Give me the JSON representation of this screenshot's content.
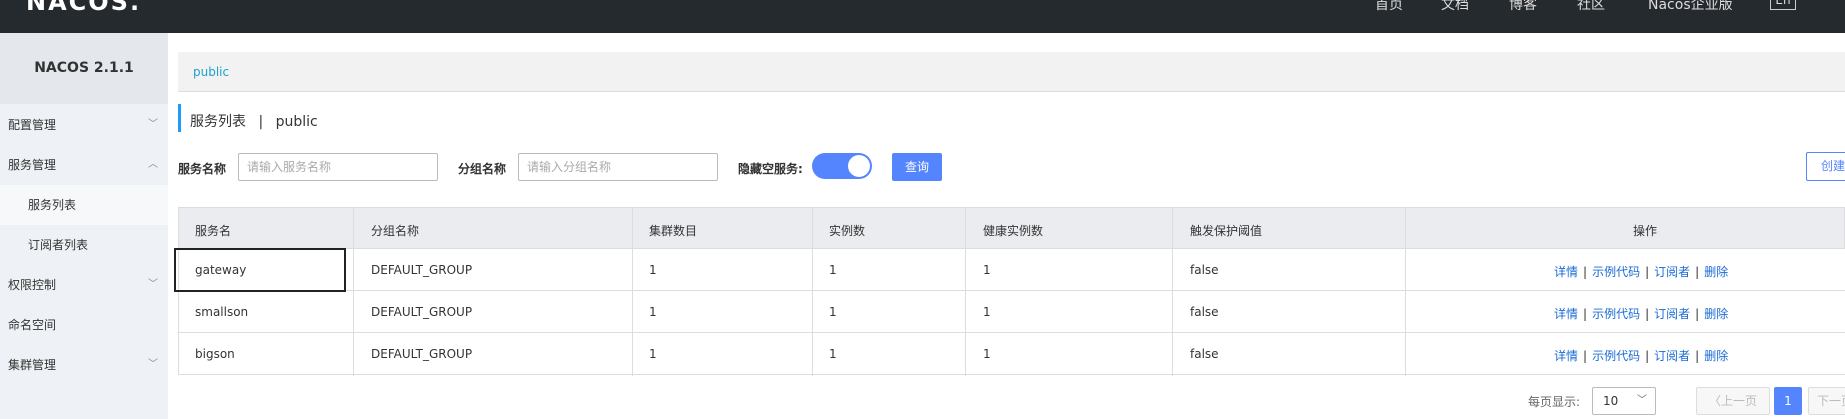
{
  "header": {
    "logo": "NACOS.",
    "nav": [
      "首页",
      "文档",
      "博客",
      "社区",
      "Nacos企业版"
    ],
    "lang": "En"
  },
  "sidebar": {
    "version": "NACOS 2.1.1",
    "items": [
      {
        "label": "配置管理",
        "arrow": "chevron-down"
      },
      {
        "label": "服务管理",
        "arrow": "chevron-up"
      },
      {
        "label": "服务列表"
      },
      {
        "label": "订阅者列表"
      },
      {
        "label": "权限控制",
        "arrow": "chevron-down"
      },
      {
        "label": "命名空间"
      },
      {
        "label": "集群管理",
        "arrow": "chevron-down"
      }
    ]
  },
  "breadcrumb": "public",
  "page": {
    "title": "服务列表",
    "separator": "|",
    "namespace": "public"
  },
  "filters": {
    "service_label": "服务名称",
    "service_placeholder": "请输入服务名称",
    "group_label": "分组名称",
    "group_placeholder": "请输入分组名称",
    "hide_empty_label": "隐藏空服务:",
    "hide_empty_on": true,
    "query_button": "查询",
    "create_button": "创建"
  },
  "table": {
    "headers": [
      "服务名",
      "分组名称",
      "集群数目",
      "实例数",
      "健康实例数",
      "触发保护阈值",
      "操作"
    ],
    "rows": [
      {
        "name": "gateway",
        "group": "DEFAULT_GROUP",
        "clusters": "1",
        "instances": "1",
        "healthy": "1",
        "threshold": "false"
      },
      {
        "name": "smallson",
        "group": "DEFAULT_GROUP",
        "clusters": "1",
        "instances": "1",
        "healthy": "1",
        "threshold": "false"
      },
      {
        "name": "bigson",
        "group": "DEFAULT_GROUP",
        "clusters": "1",
        "instances": "1",
        "healthy": "1",
        "threshold": "false"
      }
    ],
    "ops": [
      "详情",
      "示例代码",
      "订阅者",
      "删除"
    ]
  },
  "pagination": {
    "page_size_label": "每页显示:",
    "page_size": "10",
    "prev": "上一页",
    "current": "1",
    "next": "下一页"
  }
}
